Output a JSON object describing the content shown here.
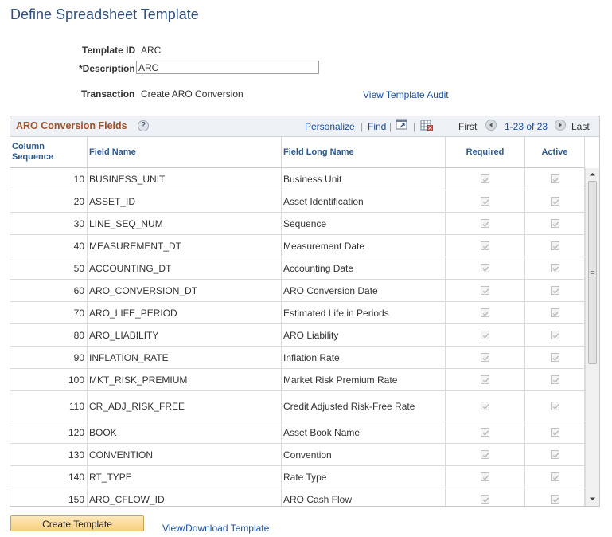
{
  "page": {
    "title": "Define Spreadsheet Template"
  },
  "form": {
    "template_id_label": "Template ID",
    "template_id_value": "ARC",
    "description_label": "*Description",
    "description_value": "ARC",
    "transaction_label": "Transaction",
    "transaction_value": "Create ARO Conversion",
    "view_audit_link": "View Template Audit"
  },
  "grid": {
    "title": "ARO Conversion Fields",
    "personalize": "Personalize",
    "find": "Find",
    "first": "First",
    "range": "1-23 of 23",
    "last": "Last",
    "columns": {
      "seq": "Column Sequence",
      "name": "Field Name",
      "long": "Field Long Name",
      "required": "Required",
      "active": "Active"
    },
    "rows": [
      {
        "seq": "10",
        "name": "BUSINESS_UNIT",
        "long": "Business Unit",
        "required": true,
        "active": true
      },
      {
        "seq": "20",
        "name": "ASSET_ID",
        "long": "Asset Identification",
        "required": true,
        "active": true
      },
      {
        "seq": "30",
        "name": "LINE_SEQ_NUM",
        "long": "Sequence",
        "required": true,
        "active": true
      },
      {
        "seq": "40",
        "name": "MEASUREMENT_DT",
        "long": "Measurement Date",
        "required": true,
        "active": true
      },
      {
        "seq": "50",
        "name": "ACCOUNTING_DT",
        "long": "Accounting Date",
        "required": true,
        "active": true
      },
      {
        "seq": "60",
        "name": "ARO_CONVERSION_DT",
        "long": "ARO Conversion Date",
        "required": true,
        "active": true
      },
      {
        "seq": "70",
        "name": "ARO_LIFE_PERIOD",
        "long": "Estimated Life in Periods",
        "required": true,
        "active": true
      },
      {
        "seq": "80",
        "name": "ARO_LIABILITY",
        "long": "ARO Liability",
        "required": true,
        "active": true
      },
      {
        "seq": "90",
        "name": "INFLATION_RATE",
        "long": "Inflation Rate",
        "required": true,
        "active": true
      },
      {
        "seq": "100",
        "name": "MKT_RISK_PREMIUM",
        "long": "Market Risk Premium Rate",
        "required": true,
        "active": true
      },
      {
        "seq": "110",
        "name": "CR_ADJ_RISK_FREE",
        "long": "Credit Adjusted Risk-Free Rate",
        "required": true,
        "active": true
      },
      {
        "seq": "120",
        "name": "BOOK",
        "long": "Asset Book Name",
        "required": true,
        "active": true
      },
      {
        "seq": "130",
        "name": "CONVENTION",
        "long": "Convention",
        "required": true,
        "active": true
      },
      {
        "seq": "140",
        "name": "RT_TYPE",
        "long": "Rate Type",
        "required": true,
        "active": true
      },
      {
        "seq": "150",
        "name": "ARO_CFLOW_ID",
        "long": "ARO Cash Flow",
        "required": true,
        "active": true
      }
    ]
  },
  "footer": {
    "create_button": "Create Template",
    "download_link": "View/Download Template"
  },
  "colors": {
    "title": "#2f4f7f",
    "grid_title": "#a0522d",
    "link": "#1a4fa0",
    "button": "#f6cf7c"
  }
}
